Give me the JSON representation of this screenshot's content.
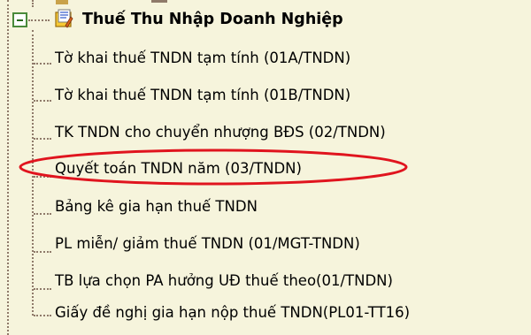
{
  "tree": {
    "root": {
      "label": "Thuế Thu Nhập Doanh Nghiệp",
      "expanded": true,
      "icon": "tax-folder-icon"
    },
    "children": [
      {
        "label": "Tờ khai thuế TNDN tạm tính (01A/TNDN)"
      },
      {
        "label": "Tờ khai thuế TNDN tạm tính (01B/TNDN)"
      },
      {
        "label": "TK TNDN cho chuyển nhượng BĐS (02/TNDN)"
      },
      {
        "label": "Quyết toán TNDN năm (03/TNDN)",
        "highlighted": true
      },
      {
        "label": "Bảng kê gia hạn thuế TNDN"
      },
      {
        "label": "PL miễn/ giảm thuế TNDN (01/MGT-TNDN)"
      },
      {
        "label": "TB lựa chọn PA hưởng UĐ thuế theo(01/TNDN)"
      },
      {
        "label": "Giấy đề nghị gia hạn nộp thuế TNDN(PL01-TT16)"
      }
    ]
  },
  "colors": {
    "background": "#f6f4dc",
    "guide_line": "#8f7a6a",
    "highlight": "#e0141e",
    "expander_border": "#4a8a3a"
  }
}
